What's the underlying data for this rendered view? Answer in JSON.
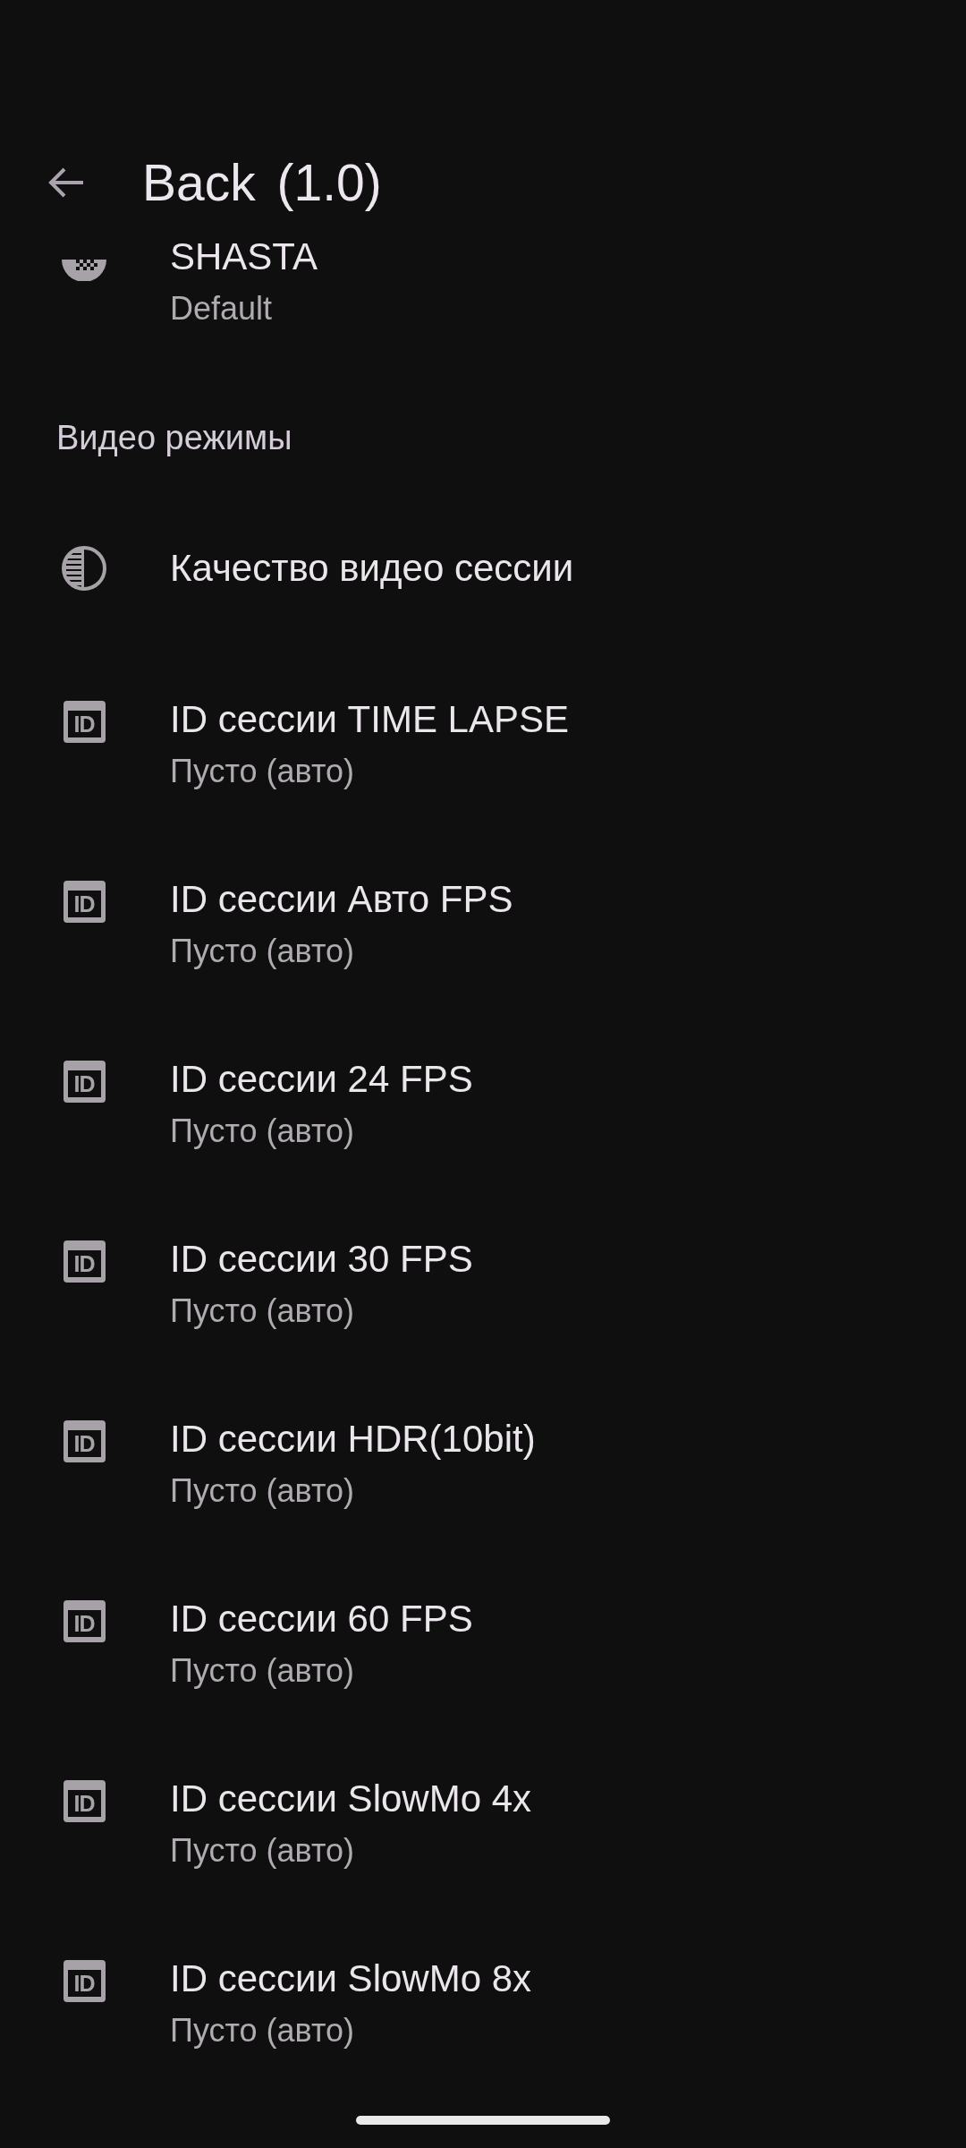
{
  "app_bar": {
    "title": "Back (1.0)"
  },
  "top_item": {
    "title": "SHASTA",
    "subtitle": "Default"
  },
  "section": {
    "title": "Видео режимы",
    "items": [
      {
        "kind": "quality",
        "title": "Качество видео сессии"
      },
      {
        "kind": "session_id",
        "icon_label": "ID",
        "title": "ID сессии TIME LAPSE",
        "subtitle": "Пусто (авто)"
      },
      {
        "kind": "session_id",
        "icon_label": "ID",
        "title": "ID сессии Авто FPS",
        "subtitle": "Пусто (авто)"
      },
      {
        "kind": "session_id",
        "icon_label": "ID",
        "title": "ID сессии 24 FPS",
        "subtitle": "Пусто (авто)"
      },
      {
        "kind": "session_id",
        "icon_label": "ID",
        "title": "ID сессии 30 FPS",
        "subtitle": "Пусто (авто)"
      },
      {
        "kind": "session_id",
        "icon_label": "ID",
        "title": "ID сессии HDR(10bit)",
        "subtitle": "Пусто (авто)"
      },
      {
        "kind": "session_id",
        "icon_label": "ID",
        "title": "ID сессии 60 FPS",
        "subtitle": "Пусто (авто)"
      },
      {
        "kind": "session_id",
        "icon_label": "ID",
        "title": "ID сессии SlowMo 4x",
        "subtitle": "Пусто (авто)"
      },
      {
        "kind": "session_id",
        "icon_label": "ID",
        "title": "ID сессии SlowMo 8x",
        "subtitle": "Пусто (авто)"
      }
    ]
  }
}
